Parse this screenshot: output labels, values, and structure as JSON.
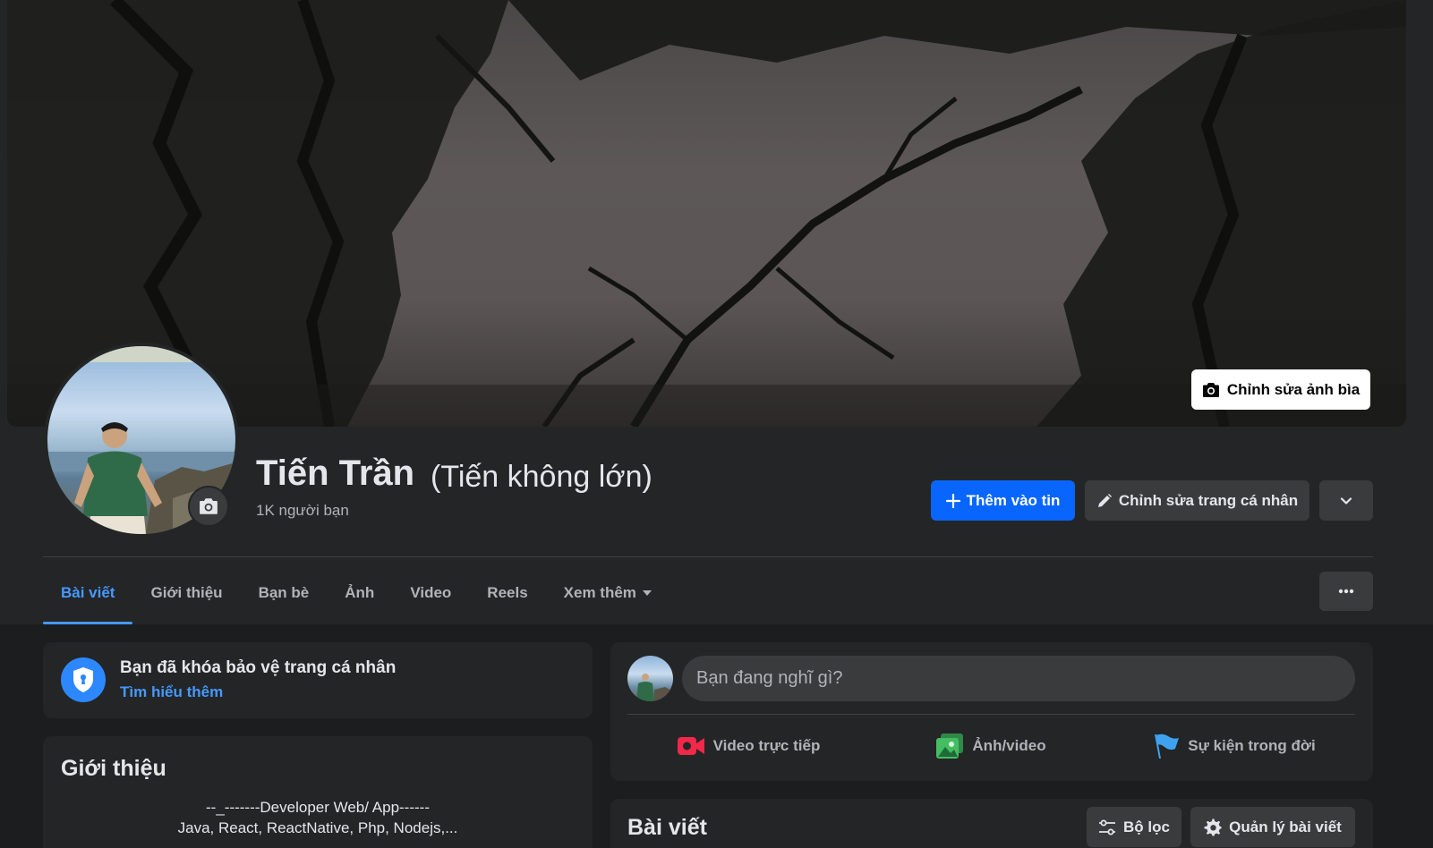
{
  "cover": {
    "edit_label": "Chỉnh sửa ảnh bìa",
    "icon": "camera-icon"
  },
  "profile": {
    "name": "Tiến Trần",
    "alternate_name": "(Tiến không lớn)",
    "friends": "1K người bạn",
    "avatar_icon": "camera-icon"
  },
  "actions": {
    "add_story": "Thêm vào tin",
    "edit_profile": "Chỉnh sửa trang cá nhân",
    "more_icon": "chevron-down-icon"
  },
  "tabs": [
    {
      "label": "Bài viết",
      "active": true
    },
    {
      "label": "Giới thiệu",
      "active": false
    },
    {
      "label": "Bạn bè",
      "active": false
    },
    {
      "label": "Ảnh",
      "active": false
    },
    {
      "label": "Video",
      "active": false
    },
    {
      "label": "Reels",
      "active": false
    },
    {
      "label": "Xem thêm",
      "active": false
    }
  ],
  "lock_notice": {
    "title": "Bạn đã khóa bảo vệ trang cá nhân",
    "link": "Tìm hiểu thêm",
    "icon": "shield-icon"
  },
  "intro": {
    "title": "Giới thiệu",
    "bio_line1": "--_-------Developer Web/ App------",
    "bio_line2": "Java, React, ReactNative, Php, Nodejs,..."
  },
  "composer": {
    "placeholder": "Bạn đang nghĩ gì?",
    "live_video": "Video trực tiếp",
    "photo_video": "Ảnh/video",
    "life_event": "Sự kiện trong đời"
  },
  "posts": {
    "title": "Bài viết",
    "filter": "Bộ lọc",
    "manage": "Quản lý bài viết"
  },
  "colors": {
    "accent": "#0866ff",
    "link": "#4599ff",
    "live_red": "#f02849",
    "photo_green": "#45bd62",
    "event_blue": "#3ea2f0"
  }
}
